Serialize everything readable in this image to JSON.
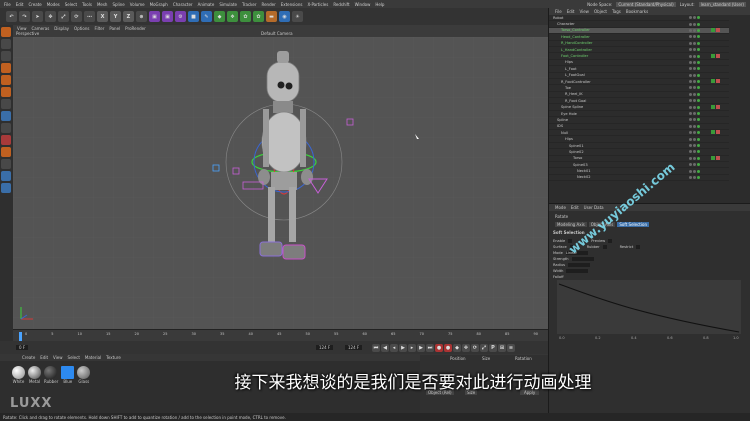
{
  "menubar": {
    "items": [
      "File",
      "Edit",
      "Create",
      "Modes",
      "Select",
      "Tools",
      "Mesh",
      "Spline",
      "Volume",
      "MoGraph",
      "Character",
      "Animate",
      "Simulate",
      "Tracker",
      "Render",
      "Extensions",
      "X-Particles",
      "Redshift",
      "Window",
      "Help"
    ],
    "node_space_label": "Node Space:",
    "node_space_value": "Current (Standard/Physical)",
    "layout_label": "Layout:",
    "layout_value": "learn_standard (User)"
  },
  "toolbar": {
    "x": "X",
    "y": "Y",
    "z": "Z"
  },
  "viewport": {
    "menu": [
      "View",
      "Cameras",
      "Display",
      "Options",
      "Filter",
      "Panel",
      "ProRender"
    ],
    "name": "Perspective",
    "camera": "Default Camera"
  },
  "timeline": {
    "ticks": [
      "0",
      "5",
      "10",
      "15",
      "20",
      "25",
      "30",
      "35",
      "40",
      "45",
      "50",
      "55",
      "60",
      "65",
      "70",
      "75",
      "80",
      "85",
      "90"
    ],
    "start": "0 F",
    "end": "124 F",
    "current": "124 F"
  },
  "materials": {
    "menu": [
      "Create",
      "Edit",
      "View",
      "Select",
      "Material",
      "Texture"
    ],
    "items": [
      "White",
      "Metal",
      "Rubber",
      "Blue",
      "Glass"
    ]
  },
  "coords": {
    "labels": [
      "Position",
      "Size",
      "Rotation"
    ],
    "object_mode": "Object (Rel)",
    "size_mode": "Size",
    "apply": "Apply"
  },
  "objects": {
    "menu": [
      "File",
      "Edit",
      "View",
      "Object",
      "Tags",
      "Bookmarks"
    ],
    "rows": [
      "Robot",
      "Character",
      "Torso_Controller",
      "Head_Controller",
      "R_HandController",
      "L_HandController",
      "Foot_Controller",
      "Hips",
      "L_Foot",
      "L_FootGoal",
      "R_FootController",
      "Toe",
      "R_Heel_IK",
      "R_Foot Goal",
      "Spine Spline",
      "Eye Hole",
      "Spline",
      "IDS",
      "Null",
      "Hips",
      "Spine01",
      "Spine02",
      "Torso",
      "Spine03",
      "Neck01",
      "Neck02"
    ]
  },
  "attributes": {
    "menu": [
      "Mode",
      "Edit",
      "User Data"
    ],
    "title": "Rotate",
    "tabs": [
      "Modeling Axis",
      "Object Axis",
      "Soft Selection"
    ],
    "section": "Soft Selection",
    "fields": [
      "Enable",
      "Preview",
      "Surface",
      "Rubber",
      "Restrict",
      "Mode",
      "Linear",
      "Strength",
      "Radius",
      "Width",
      "Falloff"
    ],
    "graph_ticks": [
      "0.0",
      "0.2",
      "0.4",
      "0.6",
      "0.8",
      "1.0"
    ]
  },
  "status": "Rotate: Click and drag to rotate elements. Hold down SHIFT to add to quantize rotation / add to the selection in point mode, CTRL to remove.",
  "subtitle": "接下来我想谈的是我们是否要对此进行动画处理",
  "watermark": "www.yuyiaoshi.com",
  "logo": "LUXX",
  "colors": {
    "accent": "#4aa3ff",
    "bg": "#2b2b2b",
    "viewport": "#545454"
  }
}
